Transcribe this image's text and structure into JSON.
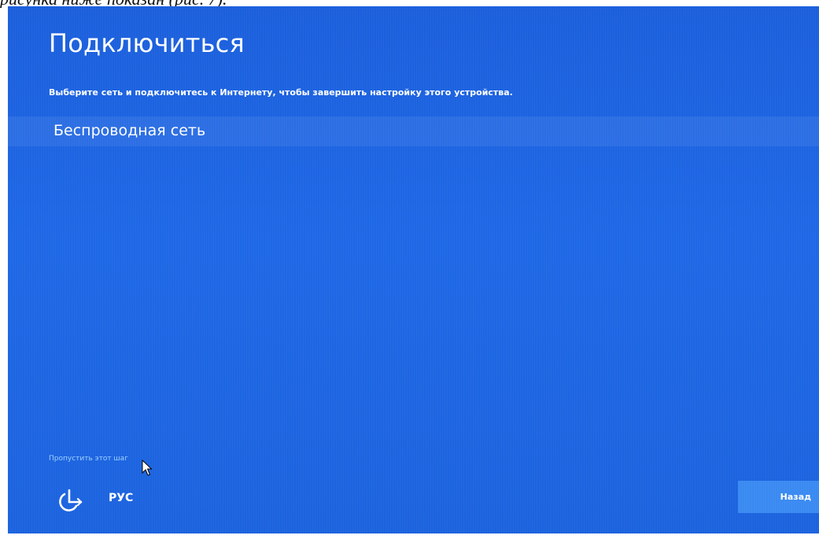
{
  "caption": {
    "text": "рисунка ниже показан (рис. 7)."
  },
  "colors": {
    "background": "#1e68e6",
    "band": "#2a73ea",
    "skip_link": "#9fd0ff",
    "back_button": "#3a8af2"
  },
  "header": {
    "title": "Подключиться",
    "subtitle": "Выберите сеть и подключитесь к Интернету, чтобы завершить настройку этого устройства."
  },
  "network": {
    "label": "Беспроводная сеть"
  },
  "footer": {
    "skip_label": "Пропустить этот шаг",
    "ease_icon": "ease-of-access-icon",
    "language": "РУС",
    "back_label": "Назад"
  }
}
